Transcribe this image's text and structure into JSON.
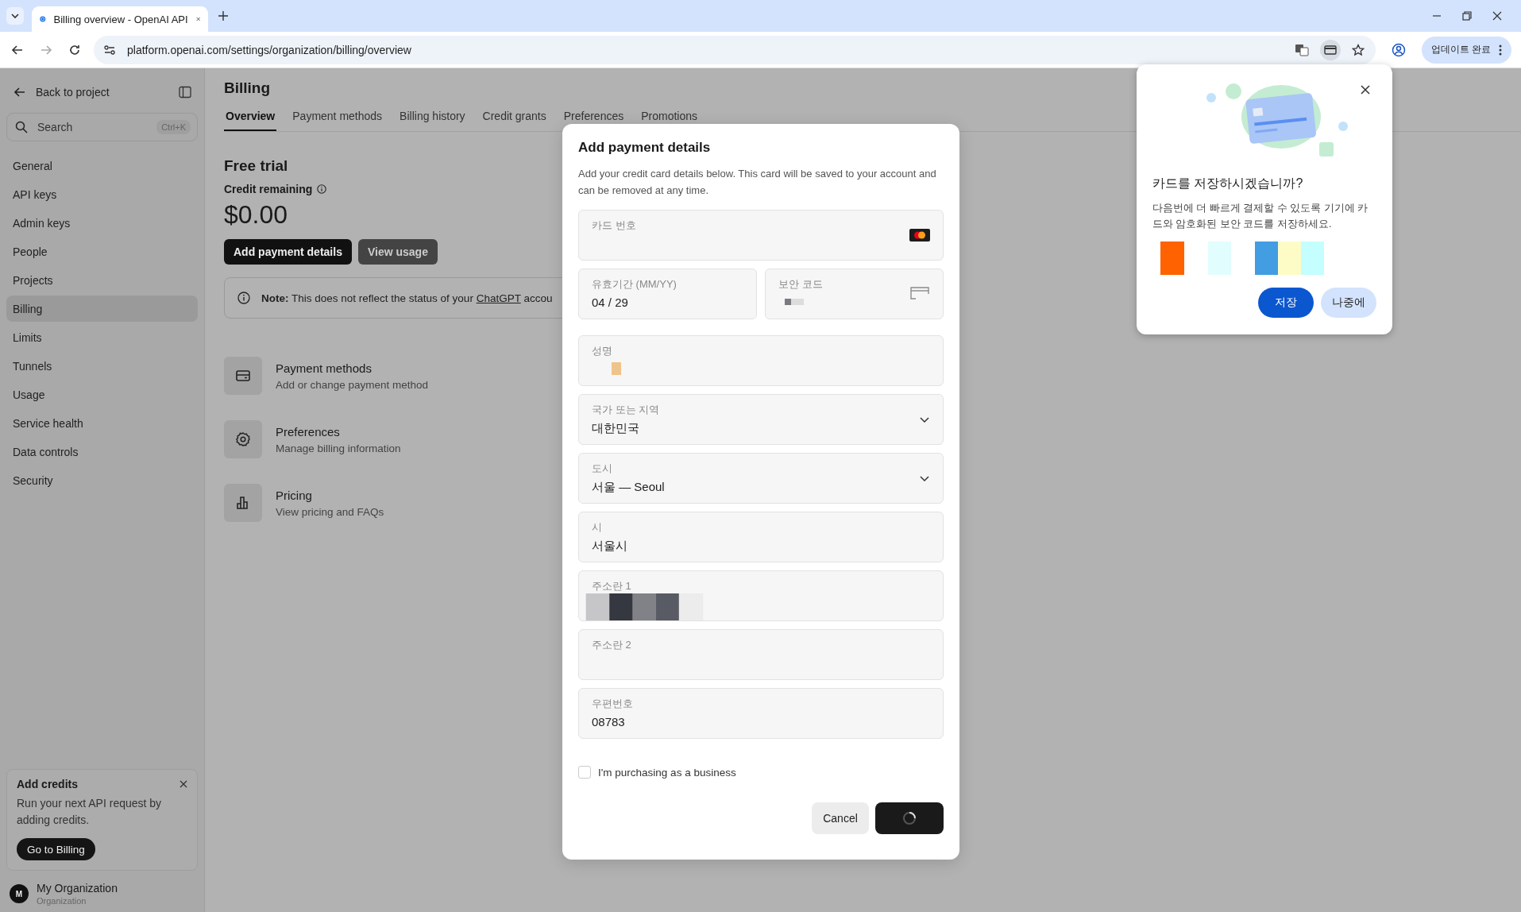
{
  "browser": {
    "tab_title": "Billing overview - OpenAI API",
    "url": "platform.openai.com/settings/organization/billing/overview",
    "update_button": "업데이트 완료"
  },
  "sidebar": {
    "back": "Back to project",
    "search": {
      "placeholder": "Search",
      "shortcut": "Ctrl+K"
    },
    "items": [
      {
        "label": "General",
        "selected": false
      },
      {
        "label": "API keys",
        "selected": false
      },
      {
        "label": "Admin keys",
        "selected": false
      },
      {
        "label": "People",
        "selected": false
      },
      {
        "label": "Projects",
        "selected": false
      },
      {
        "label": "Billing",
        "selected": true
      },
      {
        "label": "Limits",
        "selected": false
      },
      {
        "label": "Tunnels",
        "selected": false
      },
      {
        "label": "Usage",
        "selected": false
      },
      {
        "label": "Service health",
        "selected": false
      },
      {
        "label": "Data controls",
        "selected": false
      },
      {
        "label": "Security",
        "selected": false
      }
    ],
    "promo": {
      "title": "Add credits",
      "text": "Run your next API request by adding credits.",
      "button": "Go to Billing"
    },
    "org": {
      "initial": "M",
      "name": "My Organization",
      "role": "Organization"
    }
  },
  "page": {
    "title": "Billing",
    "tabs": [
      {
        "label": "Overview",
        "selected": true
      },
      {
        "label": "Payment methods",
        "selected": false
      },
      {
        "label": "Billing history",
        "selected": false
      },
      {
        "label": "Credit grants",
        "selected": false
      },
      {
        "label": "Preferences",
        "selected": false
      },
      {
        "label": "Promotions",
        "selected": false
      }
    ],
    "plan": "Free trial",
    "credit_label": "Credit remaining",
    "credit": "$0.00",
    "buttons": [
      {
        "label": "Add payment details",
        "kind": "primary"
      },
      {
        "label": "View usage",
        "kind": "secondary"
      }
    ],
    "note": {
      "before": "**Note:** This does not reflect the status of your",
      "link": "ChatGPT",
      "after": "accou"
    },
    "links": [
      {
        "kind": "card",
        "title": "Payment methods",
        "text": "Add or change payment method"
      },
      {
        "kind": "gear",
        "title": "Preferences",
        "text": "Manage billing information"
      },
      {
        "kind": "chart",
        "title": "Pricing",
        "text": "View pricing and FAQs"
      }
    ]
  },
  "modal": {
    "title": "Add payment details",
    "description": "Add your credit card details below. This card will be saved to your account and can be removed at any time.",
    "card_field": {
      "label": "카드 번호"
    },
    "expiry_field": {
      "label": "유효기간 (MM/YY)",
      "value": "04 / 29"
    },
    "cvc_field": {
      "label": "보안 코드"
    },
    "fields": [
      {
        "kind": "redacted",
        "label": "성명"
      },
      {
        "kind": "select",
        "label": "국가 또는 지역",
        "value": "대한민국"
      },
      {
        "kind": "select",
        "label": "도시",
        "value": "서울 — Seoul"
      },
      {
        "kind": "text",
        "label": "시",
        "value": "서울시"
      },
      {
        "kind": "redacted",
        "label": "주소란 1"
      },
      {
        "kind": "text",
        "label": "주소란 2"
      },
      {
        "kind": "text",
        "label": "우편번호",
        "value": "08783"
      }
    ],
    "business": {
      "label": "I'm purchasing as a business",
      "checked": false
    },
    "cancel": "Cancel",
    "submit_loading": true
  },
  "save_card_popup": {
    "title": "카드를 저장하시겠습니까?",
    "text": "다음번에 더 빠르게 결제할 수 있도록 기기에 카드와 암호화된 보안 코드를 저장하세요.",
    "save": "저장",
    "later": "나중에"
  }
}
